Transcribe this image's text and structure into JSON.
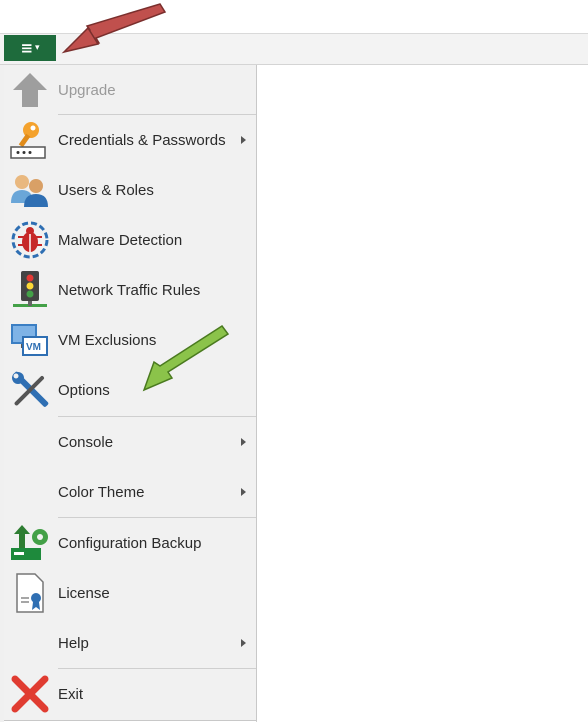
{
  "toolbar": {
    "menu_button": "≡",
    "menu_caret": "▾"
  },
  "menu": {
    "upgrade": "Upgrade",
    "credentials": "Credentials & Passwords",
    "users_roles": "Users & Roles",
    "malware": "Malware Detection",
    "network_traffic": "Network Traffic Rules",
    "vm_exclusions": "VM Exclusions",
    "options": "Options",
    "console": "Console",
    "color_theme": "Color Theme",
    "config_backup": "Configuration Backup",
    "license": "License",
    "help": "Help",
    "exit": "Exit"
  },
  "icons": {
    "upgrade": "up-arrow-icon",
    "credentials": "key-icon",
    "users": "users-icon",
    "malware": "bug-icon",
    "network": "traffic-light-icon",
    "vm": "vm-icon",
    "options": "tools-icon",
    "backup": "config-backup-icon",
    "license": "license-icon",
    "exit": "exit-icon"
  },
  "colors": {
    "accent": "#1e6b3c",
    "red_annotation": "#c0504d",
    "green_annotation": "#8bc34a"
  }
}
